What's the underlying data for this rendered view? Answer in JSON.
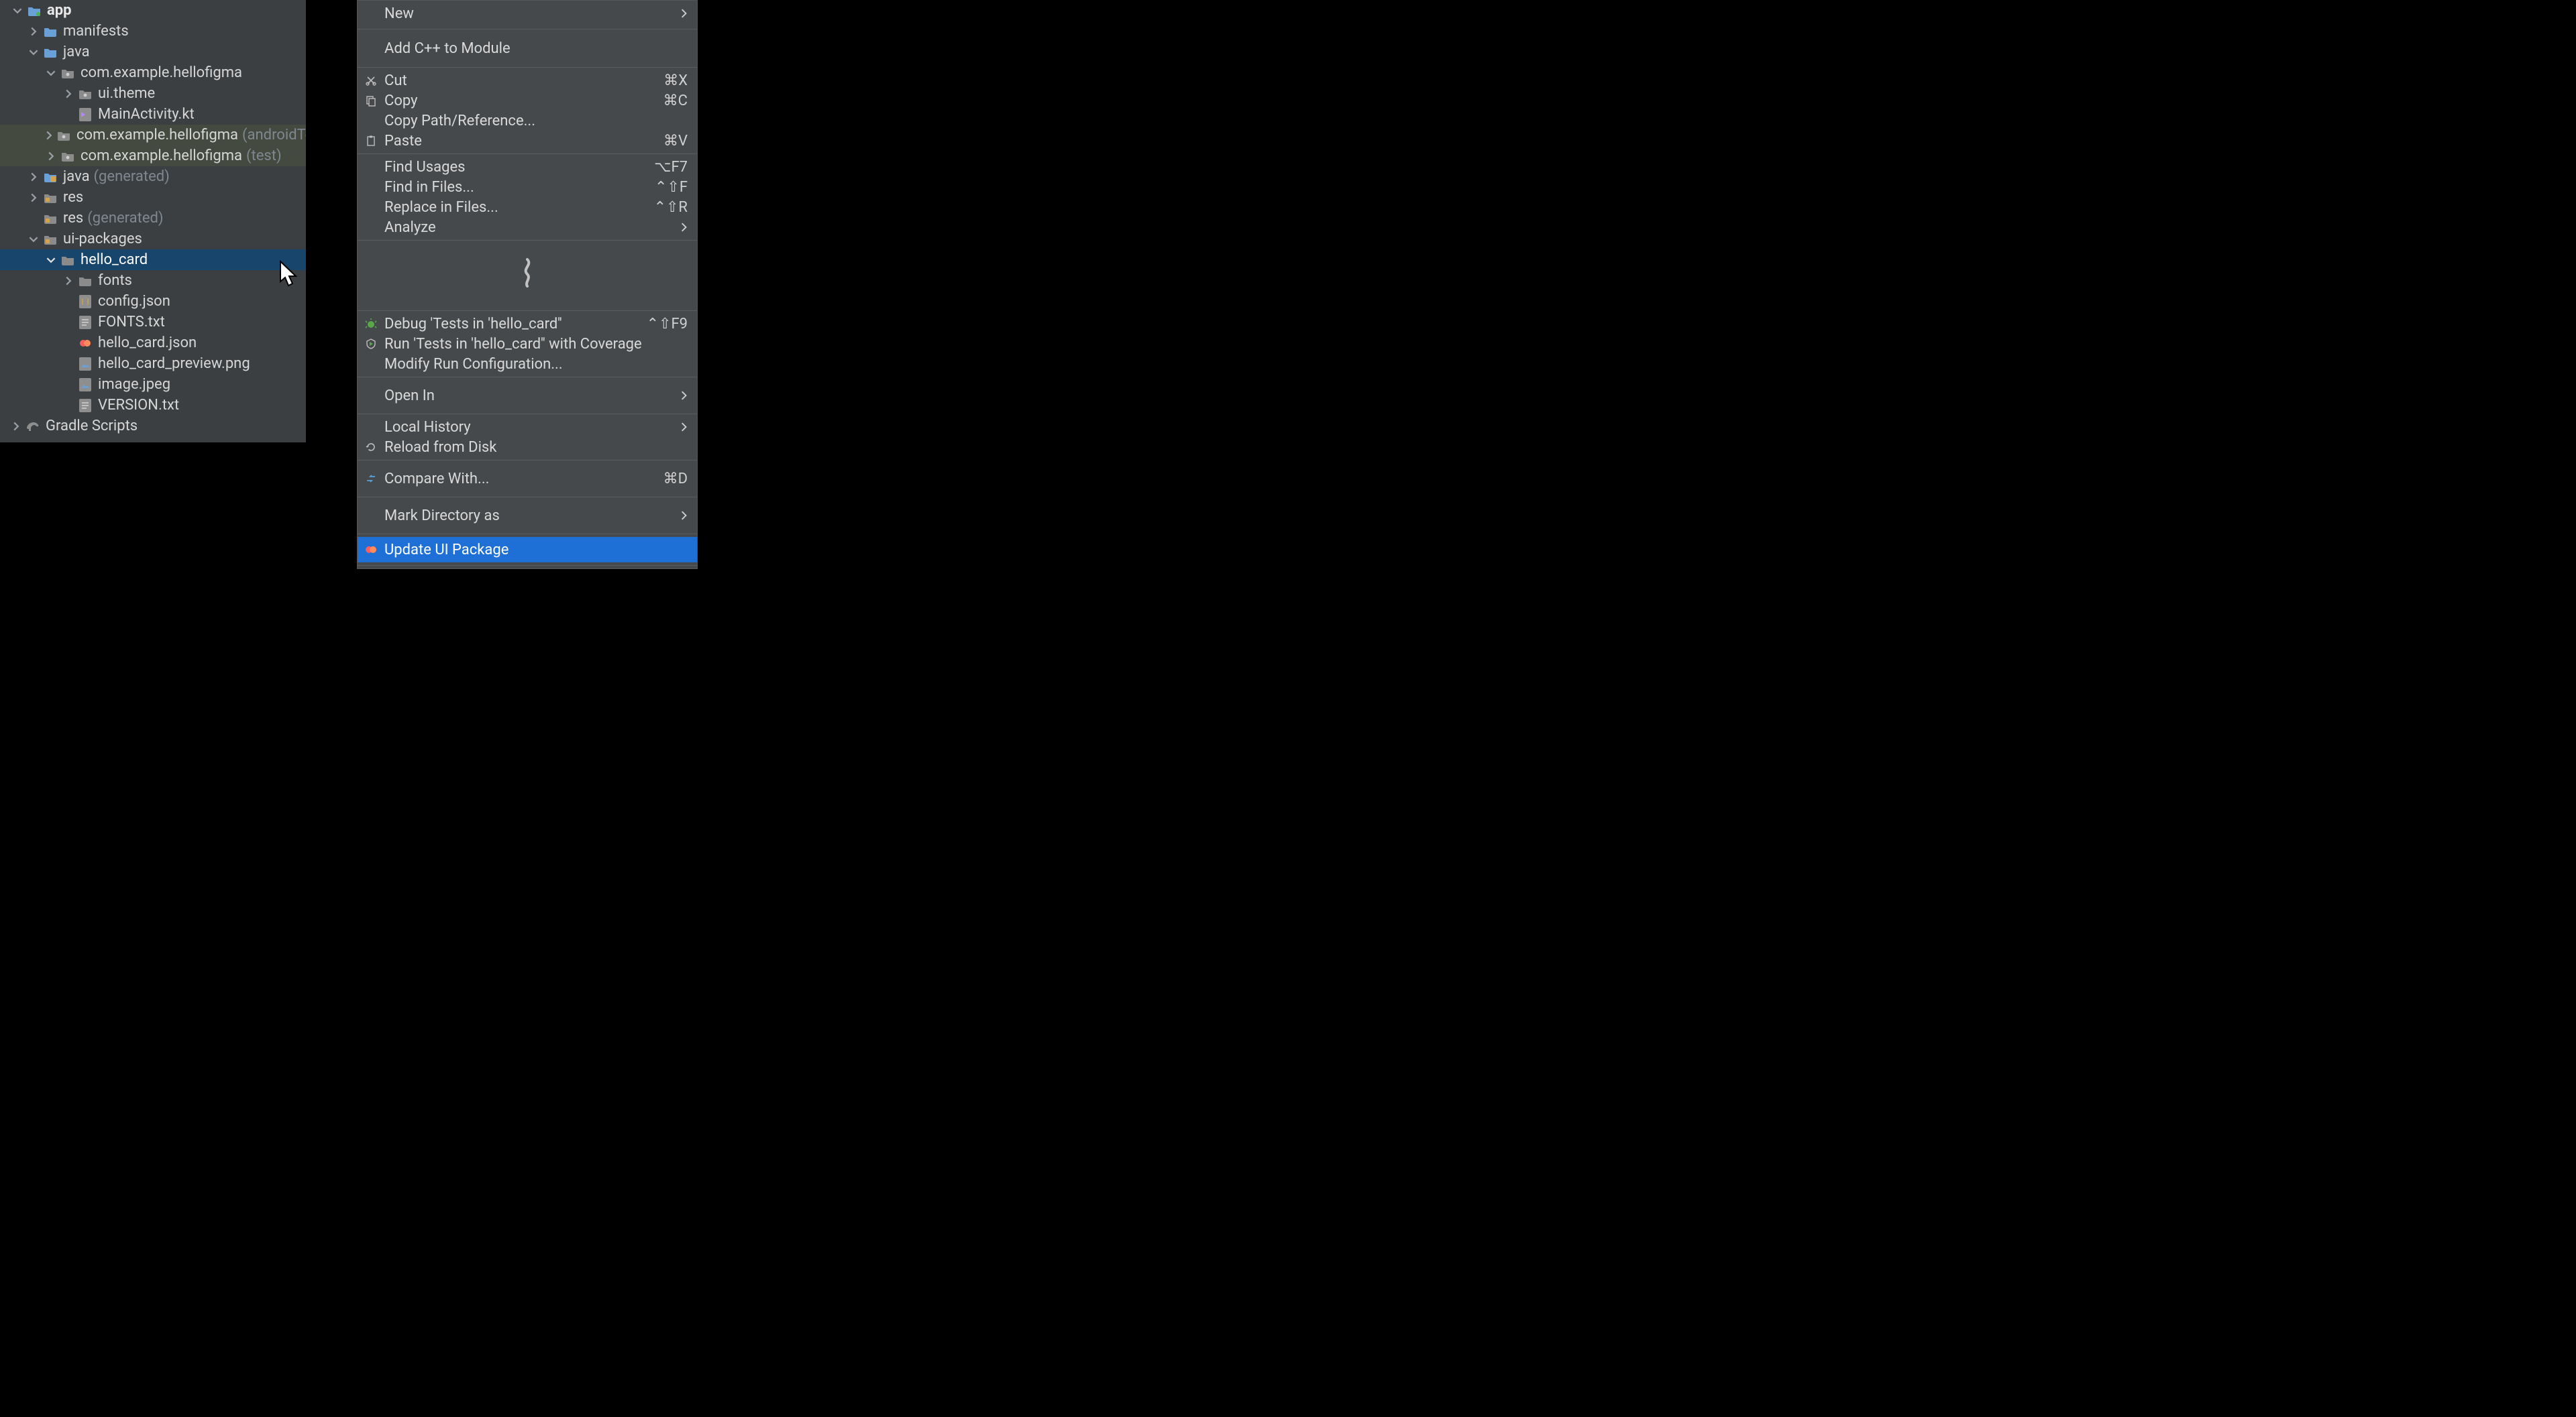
{
  "tree": {
    "app": {
      "label": "app"
    },
    "manifests": {
      "label": "manifests"
    },
    "java": {
      "label": "java"
    },
    "pkg_main": {
      "label": "com.example.hellofigma"
    },
    "ui_theme": {
      "label": "ui.theme"
    },
    "main_activity": {
      "label": "MainActivity.kt"
    },
    "pkg_androidtest": {
      "label": "com.example.hellofigma",
      "suffix": "(androidTe"
    },
    "pkg_test": {
      "label": "com.example.hellofigma",
      "suffix": "(test)"
    },
    "java_gen": {
      "label": "java",
      "suffix": "(generated)"
    },
    "res": {
      "label": "res"
    },
    "res_gen": {
      "label": "res",
      "suffix": "(generated)"
    },
    "ui_packages": {
      "label": "ui-packages"
    },
    "hello_card": {
      "label": "hello_card"
    },
    "fonts": {
      "label": "fonts"
    },
    "config_json": {
      "label": "config.json"
    },
    "fonts_txt": {
      "label": "FONTS.txt"
    },
    "hello_card_json": {
      "label": "hello_card.json"
    },
    "hello_card_preview": {
      "label": "hello_card_preview.png"
    },
    "image_jpeg": {
      "label": "image.jpeg"
    },
    "version_txt": {
      "label": "VERSION.txt"
    },
    "gradle_scripts": {
      "label": "Gradle Scripts"
    }
  },
  "menu": {
    "new": {
      "label": "New"
    },
    "add_cpp": {
      "label": "Add C++ to Module"
    },
    "cut": {
      "label": "Cut",
      "shortcut": "⌘X"
    },
    "copy": {
      "label": "Copy",
      "shortcut": "⌘C"
    },
    "copy_path": {
      "label": "Copy Path/Reference..."
    },
    "paste": {
      "label": "Paste",
      "shortcut": "⌘V"
    },
    "find_usages": {
      "label": "Find Usages",
      "shortcut": "⌥F7"
    },
    "find_in_files": {
      "label": "Find in Files...",
      "shortcut": "⌃⇧F"
    },
    "replace_in_files": {
      "label": "Replace in Files...",
      "shortcut": "⌃⇧R"
    },
    "analyze": {
      "label": "Analyze"
    },
    "debug_tests": {
      "label": "Debug 'Tests in 'hello_card''",
      "shortcut": "⌃⇧F9"
    },
    "run_cov": {
      "label": "Run 'Tests in 'hello_card'' with Coverage"
    },
    "modify_run": {
      "label": "Modify Run Configuration..."
    },
    "open_in": {
      "label": "Open In"
    },
    "local_history": {
      "label": "Local History"
    },
    "reload_disk": {
      "label": "Reload from Disk"
    },
    "compare_with": {
      "label": "Compare With...",
      "shortcut": "⌘D"
    },
    "mark_dir": {
      "label": "Mark Directory as"
    },
    "update_ui_pkg": {
      "label": "Update UI Package"
    }
  }
}
